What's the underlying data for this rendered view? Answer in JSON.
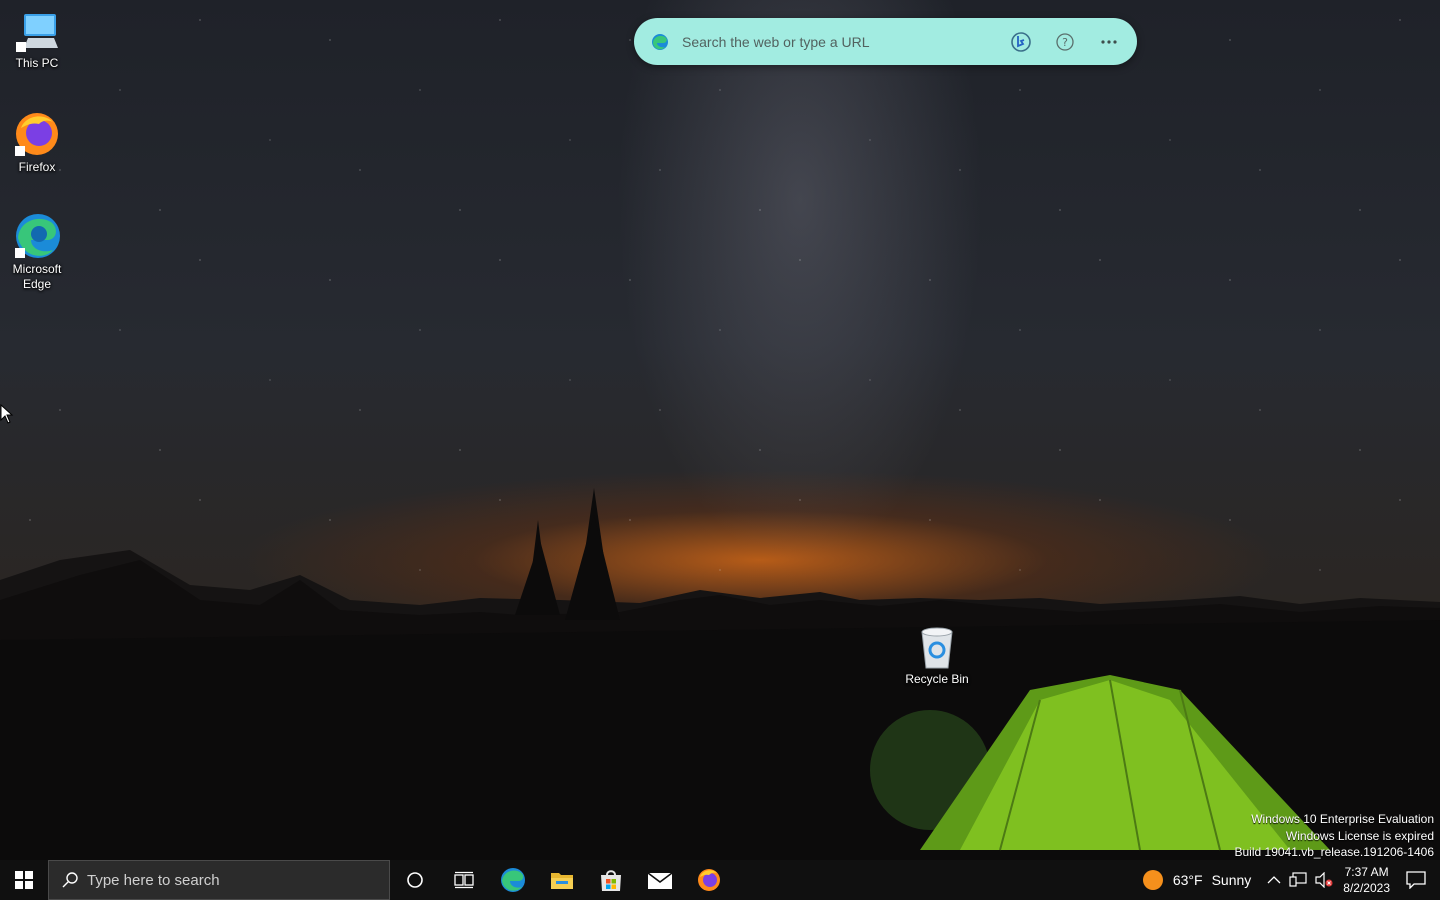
{
  "desktop": {
    "icons": [
      {
        "label": "This PC",
        "icon": "this-pc-icon"
      },
      {
        "label": "Firefox",
        "icon": "firefox-icon"
      },
      {
        "label": "Microsoft Edge",
        "icon": "edge-icon"
      },
      {
        "label": "Recycle Bin",
        "icon": "recycle-bin-icon"
      }
    ]
  },
  "search_widget": {
    "placeholder": "Search the web or type a URL",
    "buttons": [
      "bing-chat-icon",
      "help-icon",
      "more-icon"
    ],
    "color": "#a2ece1"
  },
  "watermark": {
    "line1": "Windows 10 Enterprise Evaluation",
    "line2": "Windows License is expired",
    "line3": "Build 19041.vb_release.191206-1406"
  },
  "taskbar": {
    "search_placeholder": "Type here to search",
    "pinned": [
      "cortana-icon",
      "task-view-icon",
      "edge-icon",
      "file-explorer-icon",
      "microsoft-store-icon",
      "mail-icon",
      "firefox-icon"
    ],
    "weather": {
      "temp": "63°F",
      "condition": "Sunny"
    },
    "clock": {
      "time": "7:37 AM",
      "date": "8/2/2023"
    },
    "tray_icons": [
      "show-hidden-icons-chevron",
      "network-icon",
      "volume-muted-icon",
      "notifications-icon"
    ]
  }
}
